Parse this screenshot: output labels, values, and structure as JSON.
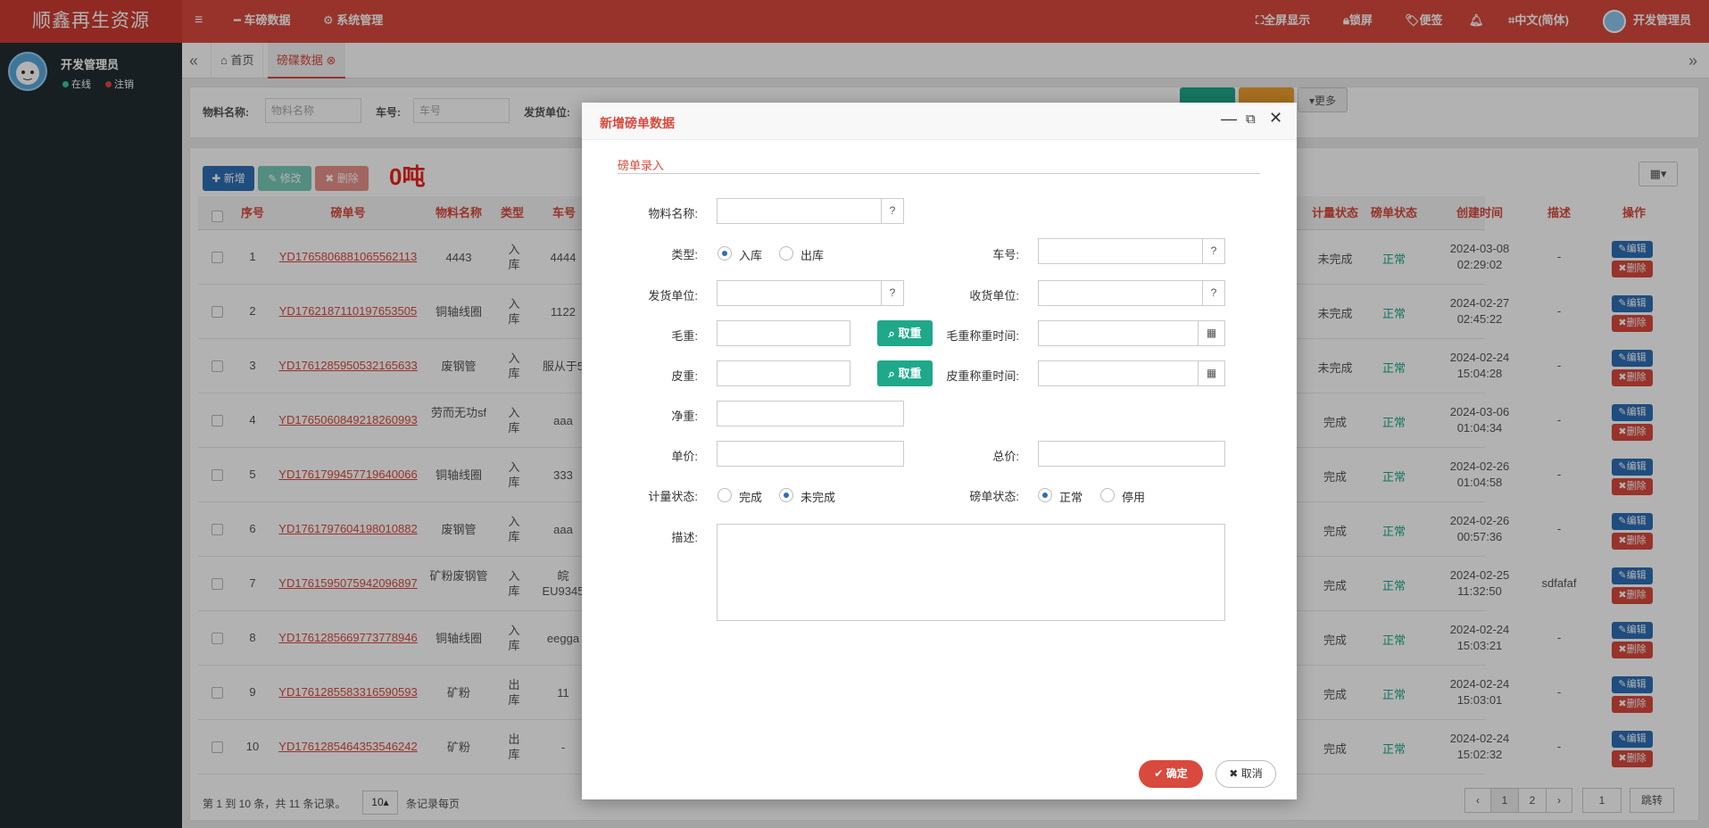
{
  "app": {
    "title": "顺鑫再生资源"
  },
  "topnav": {
    "menu_items": [
      "车磅数据",
      "系统管理"
    ],
    "right": [
      "全屏显示",
      "锁屏",
      "便签",
      "中文(简体)",
      "开发管理员"
    ]
  },
  "sidebar": {
    "user": "开发管理员",
    "online": "在线",
    "logout": "注销"
  },
  "tabs": {
    "home": "首页",
    "active": "磅碟数据"
  },
  "search": {
    "material_label": "物料名称:",
    "material_placeholder": "物料名称",
    "plate_label": "车号:",
    "plate_placeholder": "车号",
    "sender_label": "发货单位:",
    "more": "更多"
  },
  "toolbar": {
    "add": "新增",
    "edit": "修改",
    "delete": "删除",
    "total": "0吨"
  },
  "table": {
    "headers": [
      "序号",
      "磅单号",
      "物料名称",
      "类型",
      "车号",
      "计量状态",
      "磅单状态",
      "创建时间",
      "描述",
      "操作"
    ],
    "rows": [
      {
        "no": "1",
        "id": "YD1765806881065562113",
        "material": "4443",
        "type": "入库",
        "plate": "4444",
        "measure": "未完成",
        "status": "正常",
        "date": "2024-03-08",
        "time": "02:29:02",
        "desc": "-"
      },
      {
        "no": "2",
        "id": "YD1762187110197653505",
        "material": "铜轴线圈",
        "type": "入库",
        "plate": "1122",
        "measure": "未完成",
        "status": "正常",
        "date": "2024-02-27",
        "time": "02:45:22",
        "desc": "-"
      },
      {
        "no": "3",
        "id": "YD1761285950532165633",
        "material": "废钢管",
        "type": "入库",
        "plate": "服从于5",
        "measure": "未完成",
        "status": "正常",
        "date": "2024-02-24",
        "time": "15:04:28",
        "desc": "-"
      },
      {
        "no": "4",
        "id": "YD1765060849218260993",
        "material": "劳而无功sf",
        "type": "入库",
        "plate": "aaa",
        "measure": "完成",
        "status": "正常",
        "date": "2024-03-06",
        "time": "01:04:34",
        "desc": "-"
      },
      {
        "no": "5",
        "id": "YD1761799457719640066",
        "material": "铜轴线圈",
        "type": "入库",
        "plate": "333",
        "measure": "完成",
        "status": "正常",
        "date": "2024-02-26",
        "time": "01:04:58",
        "desc": "-"
      },
      {
        "no": "6",
        "id": "YD1761797604198010882",
        "material": "废钢管",
        "type": "入库",
        "plate": "aaa",
        "measure": "完成",
        "status": "正常",
        "date": "2024-02-26",
        "time": "00:57:36",
        "desc": "-"
      },
      {
        "no": "7",
        "id": "YD1761595075942096897",
        "material": "矿粉废钢管",
        "type": "入库",
        "plate": "皖EU9345",
        "measure": "完成",
        "status": "正常",
        "date": "2024-02-25",
        "time": "11:32:50",
        "desc": "sdfafaf"
      },
      {
        "no": "8",
        "id": "YD1761285669773778946",
        "material": "铜轴线圈",
        "type": "入库",
        "plate": "eegga",
        "measure": "完成",
        "status": "正常",
        "date": "2024-02-24",
        "time": "15:03:21",
        "desc": "-"
      },
      {
        "no": "9",
        "id": "YD1761285583316590593",
        "material": "矿粉",
        "type": "出库",
        "plate": "11",
        "measure": "完成",
        "status": "正常",
        "date": "2024-02-24",
        "time": "15:03:01",
        "desc": "-"
      },
      {
        "no": "10",
        "id": "YD1761285464353546242",
        "material": "矿粉",
        "type": "出库",
        "plate": "-",
        "measure": "完成",
        "status": "正常",
        "date": "2024-02-24",
        "time": "15:02:32",
        "desc": "-"
      }
    ],
    "edit_label": "编辑",
    "delete_label": "删除"
  },
  "footer": {
    "summary": "第 1 到 10 条，共 11 条记录。",
    "page_size": "10",
    "per_page": "条记录每页",
    "pages": [
      "‹",
      "1",
      "2",
      "›"
    ],
    "jump_value": "1",
    "jump_label": "跳转"
  },
  "modal": {
    "title": "新增磅单数据",
    "section": "磅单录入",
    "labels": {
      "material": "物料名称:",
      "type": "类型:",
      "plate": "车号:",
      "sender": "发货单位:",
      "receiver": "收货单位:",
      "gross": "毛重:",
      "gross_time": "毛重称重时间:",
      "tare": "皮重:",
      "tare_time": "皮重称重时间:",
      "net": "净重:",
      "unit_price": "单价:",
      "total_price": "总价:",
      "measure_status": "计量状态:",
      "bill_status": "磅单状态:",
      "desc": "描述:"
    },
    "type_options": [
      "入库",
      "出库"
    ],
    "measure_options": [
      "完成",
      "未完成"
    ],
    "bill_options": [
      "正常",
      "停用"
    ],
    "fetch_weight": "取重",
    "confirm": "确定",
    "cancel": "取消"
  }
}
